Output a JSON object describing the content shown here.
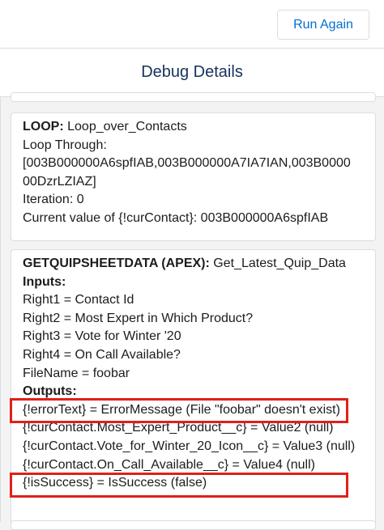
{
  "toolbar": {
    "run_again_label": "Run Again"
  },
  "header": {
    "title": "Debug Details"
  },
  "loop_card": {
    "heading_label": "LOOP:",
    "heading_value": " Loop_over_Contacts",
    "loop_through_label": "Loop Through:",
    "loop_through_line1": "[003B000000A6spfIAB,003B000000A7IA7IAN,003B0000",
    "loop_through_line2": "00DzrLZIAZ]",
    "iteration": "Iteration: 0",
    "current_value": "Current value of {!curContact}: 003B000000A6spfIAB"
  },
  "quip_card": {
    "heading_label": "GETQUIPSHEETDATA (APEX):",
    "heading_value": " Get_Latest_Quip_Data",
    "inputs_label": "Inputs:",
    "inputs": [
      "Right1 = Contact Id",
      "Right2 = Most Expert in Which Product?",
      "Right3 = Vote for Winter '20",
      "Right4 = On Call Available?",
      "FileName = foobar"
    ],
    "outputs_label": "Outputs:",
    "outputs": [
      "{!errorText} = ErrorMessage (File \"foobar\" doesn't exist)",
      "{!curContact.Most_Expert_Product__c} = Value2 (null)",
      "{!curContact.Vote_for_Winter_20_Icon__c} = Value3 (null)",
      "{!curContact.On_Call_Available__c} = Value4 (null)",
      "{!isSuccess} = IsSuccess (false)"
    ]
  },
  "colors": {
    "highlight": "#e0201a",
    "link": "#0070d2"
  }
}
